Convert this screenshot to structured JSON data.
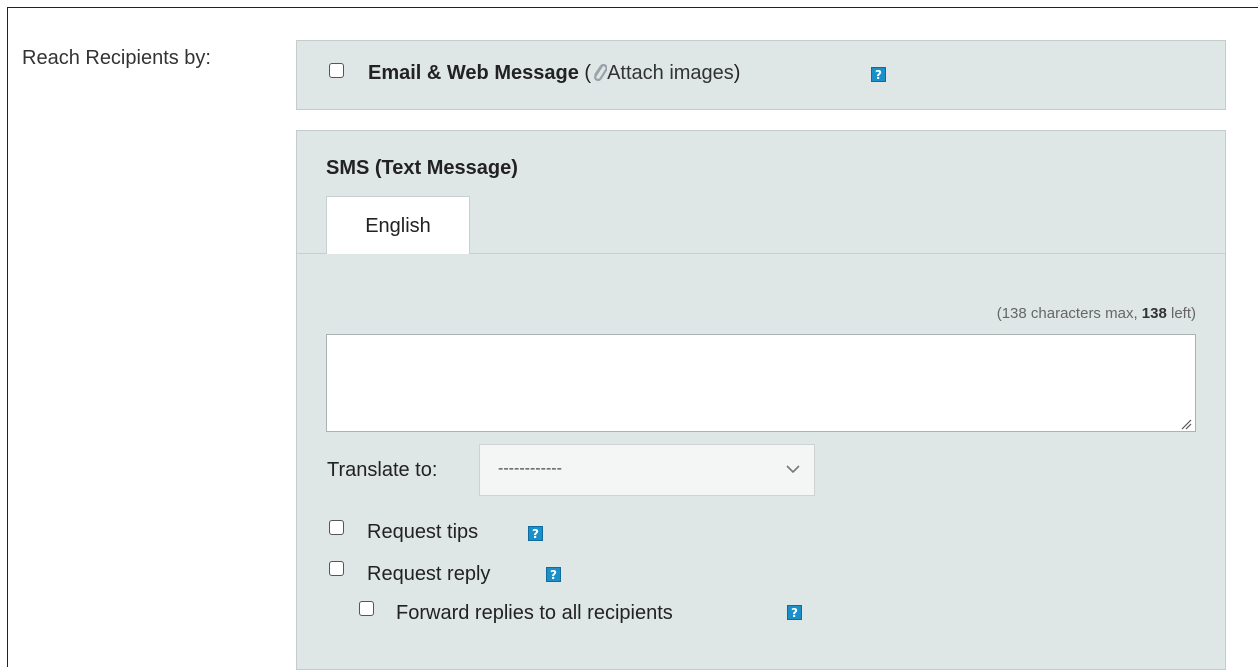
{
  "form": {
    "row_label": "Reach Recipients by:"
  },
  "email": {
    "label": "Email & Web Message",
    "open_paren": "(",
    "attach_label": "Attach images",
    "close_paren": ")",
    "checked": false
  },
  "sms": {
    "title": "SMS (Text Message)",
    "tabs": [
      {
        "label": "English",
        "active": true
      }
    ],
    "char_count": {
      "prefix": "(138 characters max, ",
      "remaining": "138",
      "suffix": " left)"
    },
    "message_value": "",
    "translate": {
      "label": "Translate to:",
      "selected": "------------"
    },
    "options": {
      "request_tips": {
        "label": "Request tips",
        "checked": false
      },
      "request_reply": {
        "label": "Request reply",
        "checked": false
      },
      "forward_replies": {
        "label": "Forward replies to all recipients",
        "checked": false
      }
    }
  },
  "help_icon_glyph": "?",
  "colors": {
    "panel_bg": "#dfe6e6",
    "help_icon_bg": "#1a8fc9"
  }
}
